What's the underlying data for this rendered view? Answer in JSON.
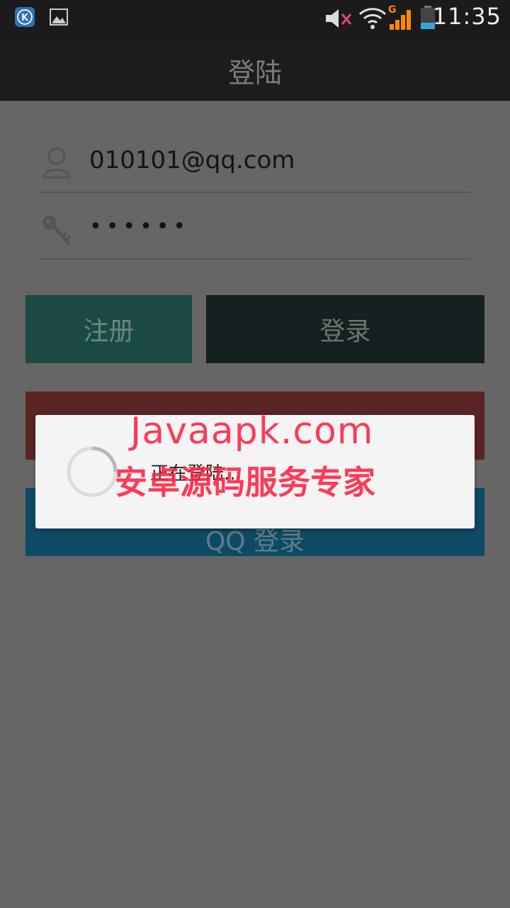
{
  "status_bar": {
    "time": "11:35",
    "icons": [
      "app-k-icon",
      "image-icon",
      "mute-icon",
      "wifi-icon",
      "signal-icon",
      "battery-icon"
    ],
    "network_label": "G"
  },
  "app_bar": {
    "title": "登陆"
  },
  "form": {
    "username_value": "010101@qq.com",
    "password_value": "••••••",
    "register_label": "注册",
    "login_label": "登录",
    "qq_login_label": "QQ 登录"
  },
  "dialog": {
    "message": "正在登陆..."
  },
  "watermark": {
    "line1": "Javaapk.com",
    "line2": "安卓源码服务专家"
  },
  "colors": {
    "register_button": "#1a4a43",
    "login_button": "#152020",
    "red_button": "#5a2423",
    "qq_button": "#0e4a64",
    "watermark": "#ff2646"
  }
}
